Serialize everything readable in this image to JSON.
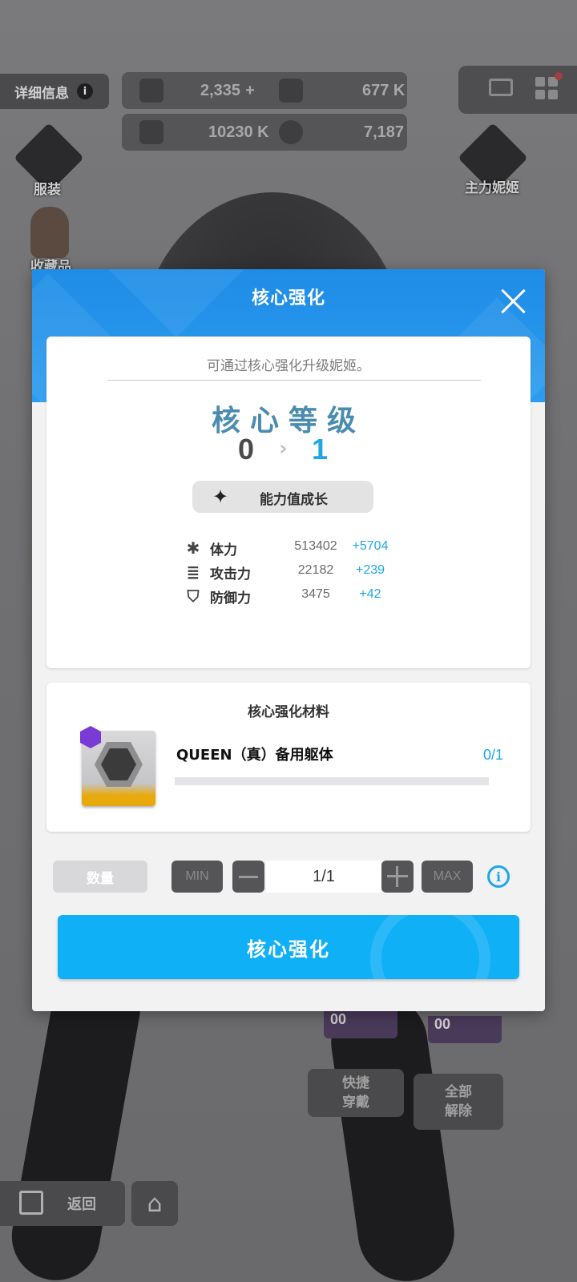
{
  "background": {
    "detail_label": "详细信息",
    "info_glyph": "i",
    "resources": [
      {
        "icon": "crystal-icon",
        "value": "2,335"
      },
      {
        "icon": "credit-icon",
        "value": "677 K"
      },
      {
        "icon": "battle-data-icon",
        "value": "10230 K"
      },
      {
        "icon": "core-dust-icon",
        "value": "7,187"
      }
    ],
    "add_glyph": "+",
    "costume_label": "服装",
    "main_nikke_label": "主力妮姬",
    "collection_label": "收藏品",
    "quick_equip_label": "快捷\n穿戴",
    "unequip_all_label": "全部\n解除",
    "card_values": [
      "00",
      "00"
    ],
    "back_label": "返回",
    "home_glyph": "⌂"
  },
  "modal": {
    "title": "核心强化",
    "subtitle": "可通过核心强化升级妮姬。",
    "level_title": "核心等级",
    "level_from": "0",
    "level_arrow": "›",
    "level_to": "1",
    "growth_label": "能力值成长",
    "growth_icon_glyph": "✦",
    "stats": [
      {
        "icon": "asterisk-icon",
        "glyph": "✱",
        "name": "体力",
        "value": "513402",
        "increase": "+5704"
      },
      {
        "icon": "attack-bars-icon",
        "glyph": "≣",
        "name": "攻击力",
        "value": "22182",
        "increase": "+239"
      },
      {
        "icon": "shield-icon",
        "glyph": "⛉",
        "name": "防御力",
        "value": "3475",
        "increase": "+42"
      }
    ],
    "material_title": "核心强化材料",
    "material_name": "QUEEN（真）备用躯体",
    "material_count": "0/1",
    "material_progress": 0,
    "quantity_label": "数量",
    "min_label": "MIN",
    "max_label": "MAX",
    "quantity_value": "1/1",
    "info_glyph": "i",
    "confirm_label": "核心强化"
  },
  "colors": {
    "header_blue": "#1f8ce6",
    "accent_blue": "#1da7e8",
    "button_blue": "#10b0f6",
    "rarity_purple": "#7a3ad6",
    "rarity_gold": "#e8a90c"
  }
}
